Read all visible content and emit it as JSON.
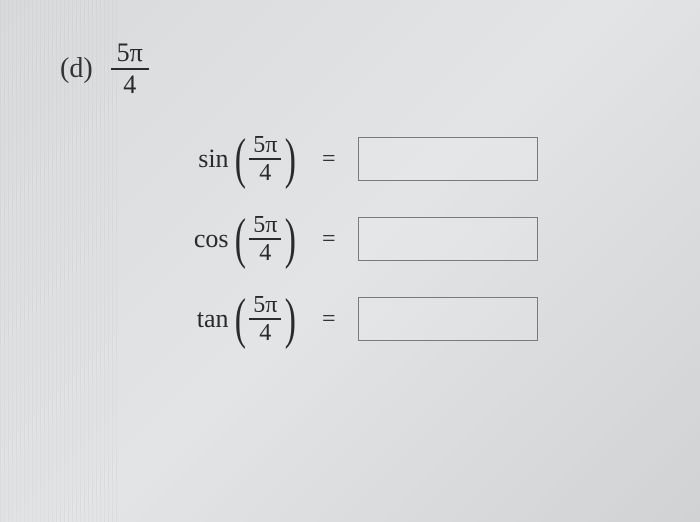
{
  "part_label": "(d)",
  "header_frac": {
    "num": "5π",
    "den": "4"
  },
  "rows": [
    {
      "func": "sin",
      "arg_num": "5π",
      "arg_den": "4",
      "eq": "=",
      "value": ""
    },
    {
      "func": "cos",
      "arg_num": "5π",
      "arg_den": "4",
      "eq": "=",
      "value": ""
    },
    {
      "func": "tan",
      "arg_num": "5π",
      "arg_den": "4",
      "eq": "=",
      "value": ""
    }
  ]
}
